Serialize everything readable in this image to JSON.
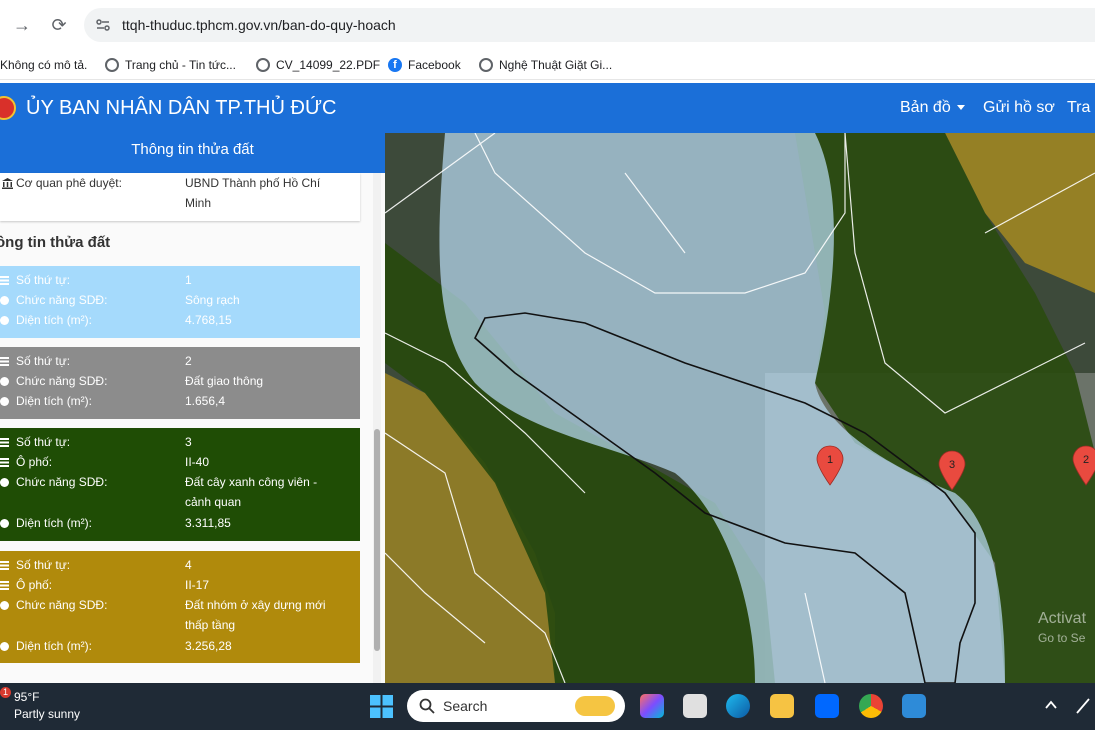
{
  "browser": {
    "url": "ttqh-thuduc.tphcm.gov.vn/ban-do-quy-hoach",
    "bookmarks": [
      {
        "label": "Không có mô tả.",
        "icon": "none"
      },
      {
        "label": "Trang chủ - Tin tức...",
        "icon": "globe-icon"
      },
      {
        "label": "CV_14099_22.PDF",
        "icon": "globe-icon"
      },
      {
        "label": "Facebook",
        "icon": "facebook-icon"
      },
      {
        "label": "Nghệ Thuật Giặt Gi...",
        "icon": "globe-icon"
      }
    ]
  },
  "header": {
    "title": "ỦY BAN NHÂN DÂN TP.THỦ ĐỨC",
    "nav": [
      "Bản đồ",
      "Gửi hồ sơ",
      "Tra"
    ]
  },
  "panel": {
    "title": "Thông tin thửa đất",
    "approver_key": "Cơ quan phê duyệt:",
    "approver_value": "UBND Thành phố Hồ Chí Minh",
    "section_title": "ông tin thửa đất",
    "parcels": [
      {
        "color": "#a5dafc",
        "text": "#ffffff",
        "rows": [
          {
            "k": "Số thứ tự:",
            "v": "1"
          },
          {
            "k": "Chức năng SDĐ:",
            "v": "Sông rạch"
          },
          {
            "k": "Diện tích (m²):",
            "v": "4.768,15"
          }
        ]
      },
      {
        "color": "#8c8c8c",
        "text": "#ffffff",
        "rows": [
          {
            "k": "Số thứ tự:",
            "v": "2"
          },
          {
            "k": "Chức năng SDĐ:",
            "v": "Đất giao thông"
          },
          {
            "k": "Diện tích (m²):",
            "v": "1.656,4"
          }
        ]
      },
      {
        "color": "#1f4d05",
        "text": "#ffffff",
        "rows": [
          {
            "k": "Số thứ tự:",
            "v": "3"
          },
          {
            "k": "Ô phố:",
            "v": "II-40"
          },
          {
            "k": "Chức năng SDĐ:",
            "v": "Đất cây xanh công viên - cảnh quan"
          },
          {
            "k": "Diện tích (m²):",
            "v": "3.311,85"
          }
        ]
      },
      {
        "color": "#b08a0c",
        "text": "#ffffff",
        "rows": [
          {
            "k": "Số thứ tự:",
            "v": "4"
          },
          {
            "k": "Ô phố:",
            "v": "II-17"
          },
          {
            "k": "Chức năng SDĐ:",
            "v": "Đất nhóm ở xây dựng mới thấp tầng"
          },
          {
            "k": "Diện tích (m²):",
            "v": "3.256,28"
          }
        ]
      }
    ]
  },
  "map": {
    "markers": [
      "1",
      "3",
      "2"
    ],
    "watermark_1": "Activat",
    "watermark_2": "Go to Se"
  },
  "taskbar": {
    "badge": "1",
    "temp": "95°F",
    "weather": "Partly sunny",
    "search": "Search"
  }
}
